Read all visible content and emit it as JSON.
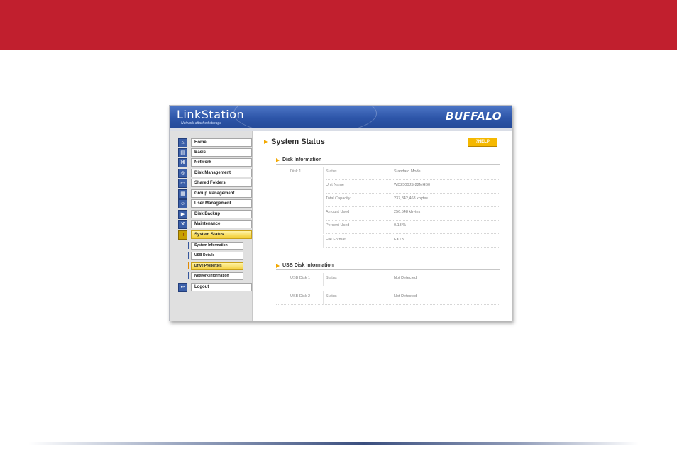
{
  "app": {
    "logo": "LinkStation",
    "logo_subtitle": "Network attached storage",
    "brand": "BUFFALO"
  },
  "colors": {
    "banner": "#c11f2e",
    "header_blue": "#2d55a8",
    "active_yellow": "#f2cc2e",
    "help_button": "#f5b800"
  },
  "sidebar": {
    "items": [
      {
        "label": "Home",
        "icon": "house-icon"
      },
      {
        "label": "Basic",
        "icon": "doc-icon"
      },
      {
        "label": "Network",
        "icon": "network-icon"
      },
      {
        "label": "Disk Management",
        "icon": "disk-icon"
      },
      {
        "label": "Shared Folders",
        "icon": "folder-icon"
      },
      {
        "label": "Group Management",
        "icon": "group-icon"
      },
      {
        "label": "User Management",
        "icon": "user-icon"
      },
      {
        "label": "Disk Backup",
        "icon": "backup-icon"
      },
      {
        "label": "Maintenance",
        "icon": "tools-icon"
      },
      {
        "label": "System Status",
        "icon": "status-icon"
      }
    ],
    "subitems": [
      {
        "label": "System Information"
      },
      {
        "label": "USB Details"
      },
      {
        "label": "Drive Properties"
      },
      {
        "label": "Network Information"
      }
    ],
    "logout": {
      "label": "Logout",
      "icon": "logout-icon"
    }
  },
  "main": {
    "title": "System Status",
    "help_label": "?HELP",
    "disk_section": {
      "title": "Disk Information",
      "disk_label": "Disk 1",
      "rows": [
        {
          "label": "Status",
          "value": "Standard Mode"
        },
        {
          "label": "Unit Name",
          "value": "WD2500JS-22MHB0"
        },
        {
          "label": "Total Capacity",
          "value": "237,842,468 kbytes"
        },
        {
          "label": "Amount Used",
          "value": "256,548 kbytes"
        },
        {
          "label": "Percent Used",
          "value": "0.13 %"
        },
        {
          "label": "File Format",
          "value": "EXT3"
        }
      ]
    },
    "usb_section": {
      "title": "USB Disk Information",
      "rows": [
        {
          "disk": "USB Disk 1",
          "label": "Status",
          "value": "Not Detected"
        },
        {
          "disk": "USB Disk 2",
          "label": "Status",
          "value": "Not Detected"
        }
      ]
    }
  }
}
